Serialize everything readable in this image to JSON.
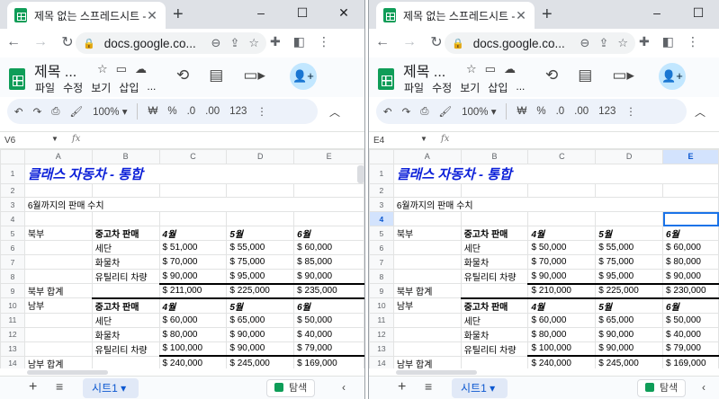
{
  "tab_title": "제목 없는 스프레드시트 - Go",
  "url": "docs.google.co...",
  "doc_title": "제목 ...",
  "menus": [
    "파일",
    "수정",
    "보기",
    "삽입",
    "..."
  ],
  "zoom": "100%",
  "toolbar": {
    "won": "₩",
    "percent": "%",
    "dec_down": ".0",
    "dec_up": ".00",
    "numfmt": "123"
  },
  "columns": [
    "A",
    "B",
    "C",
    "D",
    "E"
  ],
  "sheet_name": "시트1",
  "explore_label": "탐색",
  "left": {
    "cell_ref": "V6",
    "rows": [
      {
        "n": "1",
        "a": "클래스 자동차 - 통합",
        "b": "",
        "c": "",
        "d": "",
        "e": ""
      },
      {
        "n": "2",
        "a": "",
        "b": "",
        "c": "",
        "d": "",
        "e": ""
      },
      {
        "n": "3",
        "a": "6월까지의 판매 수치",
        "b": "",
        "c": "",
        "d": "",
        "e": ""
      },
      {
        "n": "4",
        "a": "",
        "b": "",
        "c": "",
        "d": "",
        "e": ""
      },
      {
        "n": "5",
        "a": "북부",
        "b": "중고차 판매",
        "c": "4월",
        "d": "5월",
        "e": "6월"
      },
      {
        "n": "6",
        "a": "",
        "b": "세단",
        "c": "$ 51,000",
        "d": "$ 55,000",
        "e": "$ 60,000"
      },
      {
        "n": "7",
        "a": "",
        "b": "화물차",
        "c": "$ 70,000",
        "d": "$ 75,000",
        "e": "$ 85,000"
      },
      {
        "n": "8",
        "a": "",
        "b": "유틸리티 차량",
        "c": "$ 90,000",
        "d": "$ 95,000",
        "e": "$ 90,000"
      },
      {
        "n": "9",
        "a": "북부 합계",
        "b": "",
        "c": "$ 211,000",
        "d": "$ 225,000",
        "e": "$ 235,000"
      },
      {
        "n": "10",
        "a": "남부",
        "b": "중고차 판매",
        "c": "4월",
        "d": "5월",
        "e": "6월"
      },
      {
        "n": "11",
        "a": "",
        "b": "세단",
        "c": "$ 60,000",
        "d": "$ 65,000",
        "e": "$ 50,000"
      },
      {
        "n": "12",
        "a": "",
        "b": "화물차",
        "c": "$ 80,000",
        "d": "$ 90,000",
        "e": "$ 40,000"
      },
      {
        "n": "13",
        "a": "",
        "b": "유틸리티 차량",
        "c": "$ 100,000",
        "d": "$ 90,000",
        "e": "$ 79,000"
      },
      {
        "n": "14",
        "a": "남부 합계",
        "b": "",
        "c": "$ 240,000",
        "d": "$ 245,000",
        "e": "$ 169,000"
      }
    ]
  },
  "right": {
    "cell_ref": "E4",
    "rows": [
      {
        "n": "1",
        "a": "클래스 자동차 - 통합",
        "b": "",
        "c": "",
        "d": "",
        "e": ""
      },
      {
        "n": "2",
        "a": "",
        "b": "",
        "c": "",
        "d": "",
        "e": ""
      },
      {
        "n": "3",
        "a": "6월까지의 판매 수치",
        "b": "",
        "c": "",
        "d": "",
        "e": ""
      },
      {
        "n": "4",
        "a": "",
        "b": "",
        "c": "",
        "d": "",
        "e": ""
      },
      {
        "n": "5",
        "a": "북부",
        "b": "중고차 판매",
        "c": "4월",
        "d": "5월",
        "e": "6월"
      },
      {
        "n": "6",
        "a": "",
        "b": "세단",
        "c": "$ 50,000",
        "d": "$ 55,000",
        "e": "$ 60,000"
      },
      {
        "n": "7",
        "a": "",
        "b": "화물차",
        "c": "$ 70,000",
        "d": "$ 75,000",
        "e": "$ 80,000"
      },
      {
        "n": "8",
        "a": "",
        "b": "유틸리티 차량",
        "c": "$ 90,000",
        "d": "$ 95,000",
        "e": "$ 90,000"
      },
      {
        "n": "9",
        "a": "북부 합계",
        "b": "",
        "c": "$ 210,000",
        "d": "$ 225,000",
        "e": "$ 230,000"
      },
      {
        "n": "10",
        "a": "남부",
        "b": "중고차 판매",
        "c": "4월",
        "d": "5월",
        "e": "6월"
      },
      {
        "n": "11",
        "a": "",
        "b": "세단",
        "c": "$ 60,000",
        "d": "$ 65,000",
        "e": "$ 50,000"
      },
      {
        "n": "12",
        "a": "",
        "b": "화물차",
        "c": "$ 80,000",
        "d": "$ 90,000",
        "e": "$ 40,000"
      },
      {
        "n": "13",
        "a": "",
        "b": "유틸리티 차량",
        "c": "$ 100,000",
        "d": "$ 90,000",
        "e": "$ 79,000"
      },
      {
        "n": "14",
        "a": "남부 합계",
        "b": "",
        "c": "$ 240,000",
        "d": "$ 245,000",
        "e": "$ 169,000"
      }
    ]
  }
}
